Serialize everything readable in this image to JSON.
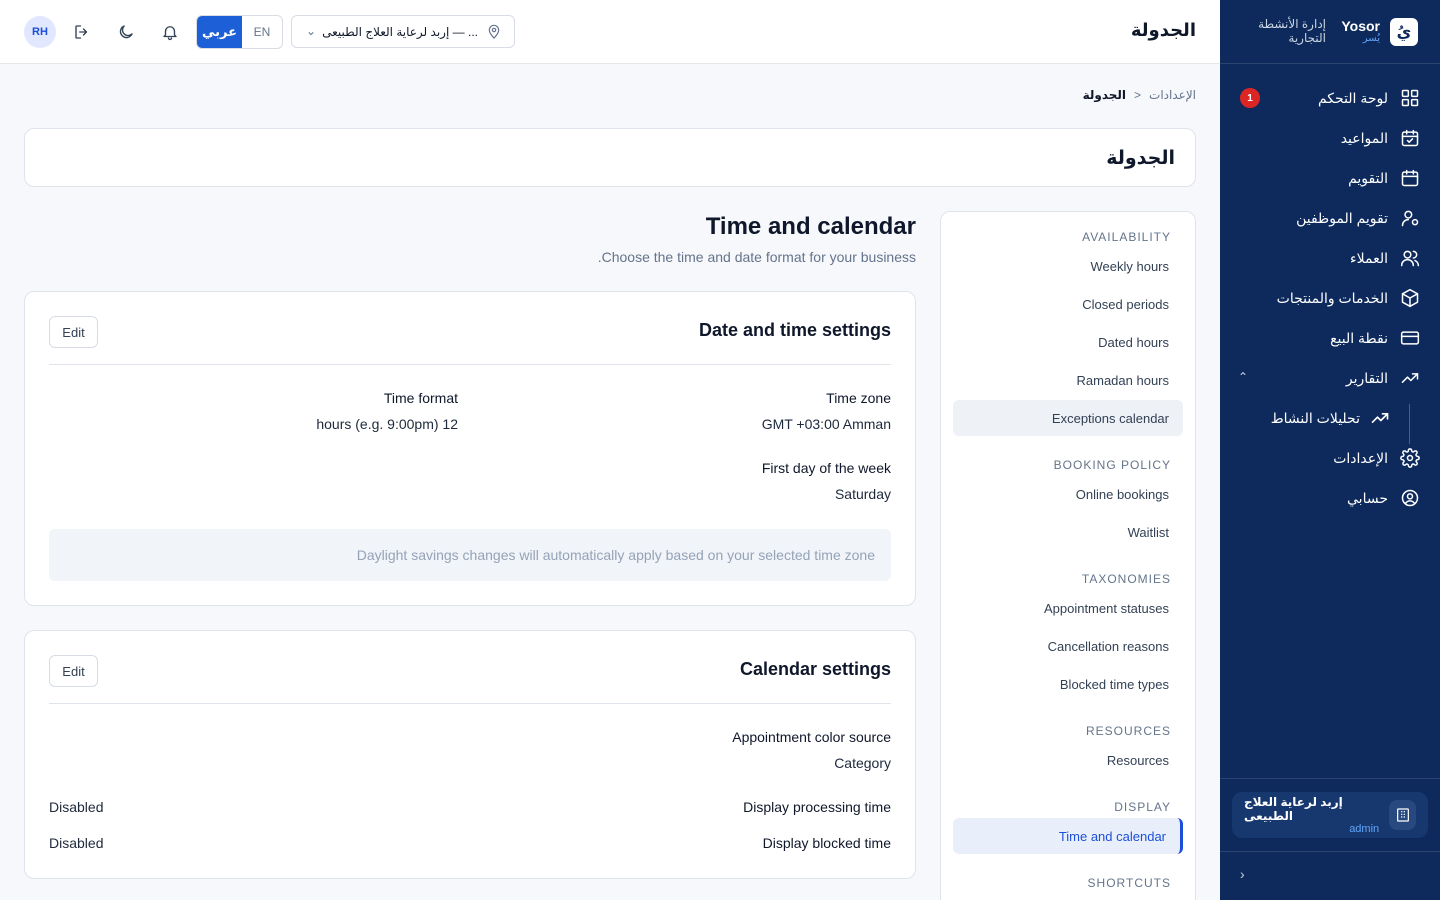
{
  "header": {
    "title": "الجدولة",
    "avatar_initials": "RH",
    "lang_ar": "عربي",
    "lang_en": "EN",
    "location": "إربد لرعاية العلاج الطبيعى — ..."
  },
  "sidebar": {
    "brand_name": "Yosor",
    "brand_sub": "يُسر",
    "brand_logo": "يُ",
    "brand_tag": "إدارة الأنشطة التجارية",
    "items": [
      {
        "label": "لوحة التحكم",
        "icon": "dashboard-icon",
        "badge": "1"
      },
      {
        "label": "المواعيد",
        "icon": "calendar-check-icon"
      },
      {
        "label": "التقويم",
        "icon": "calendar-icon"
      },
      {
        "label": "تقويم الموظفين",
        "icon": "user-gear-icon"
      },
      {
        "label": "العملاء",
        "icon": "users-icon"
      },
      {
        "label": "الخدمات والمنتجات",
        "icon": "box-icon"
      },
      {
        "label": "نقطة البيع",
        "icon": "credit-card-icon"
      },
      {
        "label": "التقارير",
        "icon": "trending-up-icon"
      }
    ],
    "sub_item": {
      "label": "تحليلات النشاط",
      "icon": "trending-up-icon"
    },
    "items_after": [
      {
        "label": "الإعدادات",
        "icon": "settings-icon"
      },
      {
        "label": "حسابي",
        "icon": "user-circle-icon"
      }
    ],
    "branch": {
      "name": "إربد لرعاية العلاج الطبيعى",
      "role": "admin"
    }
  },
  "breadcrumb": {
    "parent": "الإعدادات",
    "separator": "<",
    "current": "الجدولة"
  },
  "page_title": "الجدولة",
  "settings_nav": {
    "groups": [
      {
        "title": "AVAILABILITY",
        "items": [
          "Weekly hours",
          "Closed periods",
          "Dated hours",
          "Ramadan hours",
          "Exceptions calendar"
        ]
      },
      {
        "title": "BOOKING POLICY",
        "items": [
          "Online bookings",
          "Waitlist"
        ]
      },
      {
        "title": "TAXONOMIES",
        "items": [
          "Appointment statuses",
          "Cancellation reasons",
          "Blocked time types"
        ]
      },
      {
        "title": "RESOURCES",
        "items": [
          "Resources"
        ]
      },
      {
        "title": "DISPLAY",
        "items": [
          "Time and calendar"
        ]
      },
      {
        "title": "SHORTCUTS",
        "items": []
      }
    ],
    "active_item": "Time and calendar",
    "hovered_item": "Exceptions calendar"
  },
  "section": {
    "title": "Time and calendar",
    "subtitle": ".Choose the time and date format for your business"
  },
  "date_time_card": {
    "title": "Date and time settings",
    "edit_label": "Edit",
    "time_zone_label": "Time zone",
    "time_zone_value": "GMT +03:00 Amman",
    "time_format_label": "Time format",
    "time_format_value": "hours (e.g. 9:00pm) 12",
    "first_day_label": "First day of the week",
    "first_day_value": "Saturday",
    "notice": "Daylight savings changes will automatically apply based on your selected time zone"
  },
  "calendar_card": {
    "title": "Calendar settings",
    "edit_label": "Edit",
    "color_source_label": "Appointment color source",
    "color_source_value": "Category",
    "processing_label": "Display processing time",
    "processing_value": "Disabled",
    "blocked_label": "Display blocked time",
    "blocked_value": "Disabled"
  },
  "colors": {
    "sidebar_bg": "#0e2a5c",
    "accent": "#1d4ed8",
    "badge": "#dc2626"
  }
}
